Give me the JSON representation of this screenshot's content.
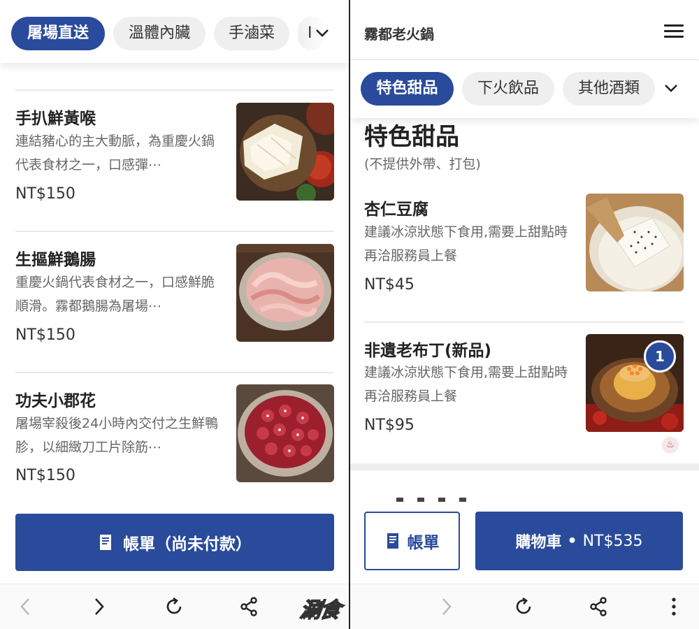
{
  "left": {
    "chips": [
      {
        "label": "屠場直送",
        "active": true
      },
      {
        "label": "溫體內臟",
        "active": false
      },
      {
        "label": "手滷菜",
        "active": false
      },
      {
        "label": "I",
        "active": false
      }
    ],
    "items": [
      {
        "name": "手扒鮮黃喉",
        "desc": "連結豬心的主大動脈，為重慶火鍋代表食材之一，口感彈⋯",
        "price": "NT$150"
      },
      {
        "name": "生摳鮮鵝腸",
        "desc": "重慶火鍋代表食材之一，口感鮮脆順滑。霧都鵝腸為屠場⋯",
        "price": "NT$150"
      },
      {
        "name": "功夫小郡花",
        "desc": "屠場宰殺後24小時內交付之生鮮鴨胗，以細緻刀工片除筋⋯",
        "price": "NT$150"
      }
    ],
    "bill_button": "帳單（尚未付款）"
  },
  "right": {
    "app_title": "霧都老火鍋",
    "chips": [
      {
        "label": "特色甜品",
        "active": true
      },
      {
        "label": "下火飲品",
        "active": false
      },
      {
        "label": "其他酒類",
        "active": false
      }
    ],
    "section_title": "特色甜品",
    "section_subtitle": "(不提供外帶、打包)",
    "items": [
      {
        "name": "杏仁豆腐",
        "desc": "建議冰涼狀態下食用,需要上甜點時再洽服務員上餐",
        "price": "NT$45"
      },
      {
        "name": "非遺老布丁(新品)",
        "desc": "建議冰涼狀態下食用,需要上甜點時再洽服務員上餐",
        "price": "NT$95",
        "badge": "1"
      }
    ],
    "bill_button": "帳單",
    "cart_label": "購物車",
    "cart_sep": "•",
    "cart_total": "NT$535"
  },
  "watermark": "涮食",
  "colors": {
    "brand": "#2a4b9b",
    "chip_bg": "#efefef"
  },
  "icons": [
    "back-icon",
    "forward-icon",
    "refresh-icon",
    "share-icon",
    "more-icon",
    "receipt-icon",
    "menu-icon",
    "chevron-down-icon"
  ]
}
